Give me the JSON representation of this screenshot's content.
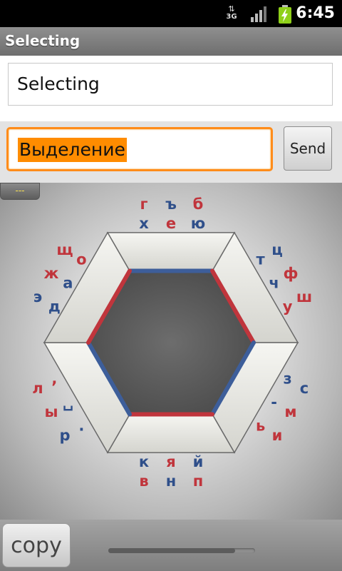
{
  "status_bar": {
    "network_label": "3G",
    "time": "6:45"
  },
  "title_bar": {
    "title": "Selecting"
  },
  "echo": {
    "text": "Selecting"
  },
  "input": {
    "value": "Выделение"
  },
  "send_button": {
    "label": "Send"
  },
  "keyboard_tab": {
    "label": "---"
  },
  "hex_keyboard": {
    "colors": {
      "red": "#c0353c",
      "blue": "#2f4f8a"
    },
    "keys": [
      {
        "ch": "г",
        "c": "red"
      },
      {
        "ch": "ъ",
        "c": "blue"
      },
      {
        "ch": "б",
        "c": "red"
      },
      {
        "ch": "х",
        "c": "blue"
      },
      {
        "ch": "е",
        "c": "red"
      },
      {
        "ch": "ю",
        "c": "blue"
      },
      {
        "ch": "ц",
        "c": "blue"
      },
      {
        "ch": "ф",
        "c": "red"
      },
      {
        "ch": "ш",
        "c": "red"
      },
      {
        "ch": "т",
        "c": "blue"
      },
      {
        "ch": "ч",
        "c": "blue"
      },
      {
        "ch": "у",
        "c": "red"
      },
      {
        "ch": "с",
        "c": "blue"
      },
      {
        "ch": "м",
        "c": "red"
      },
      {
        "ch": "и",
        "c": "red"
      },
      {
        "ch": "з",
        "c": "blue"
      },
      {
        "ch": "-",
        "c": "blue"
      },
      {
        "ch": "ь",
        "c": "red"
      },
      {
        "ch": "п",
        "c": "red"
      },
      {
        "ch": "н",
        "c": "blue"
      },
      {
        "ch": "в",
        "c": "red"
      },
      {
        "ch": "й",
        "c": "blue"
      },
      {
        "ch": "я",
        "c": "red"
      },
      {
        "ch": "к",
        "c": "blue"
      },
      {
        "ch": "р",
        "c": "blue"
      },
      {
        "ch": "ы",
        "c": "red"
      },
      {
        "ch": "л",
        "c": "red"
      },
      {
        "ch": ".",
        "c": "blue"
      },
      {
        "ch": "␣",
        "c": "blue"
      },
      {
        "ch": ",",
        "c": "red"
      },
      {
        "ch": "э",
        "c": "blue"
      },
      {
        "ch": "ж",
        "c": "red"
      },
      {
        "ch": "щ",
        "c": "red"
      },
      {
        "ch": "д",
        "c": "blue"
      },
      {
        "ch": "а",
        "c": "blue"
      },
      {
        "ch": "о",
        "c": "red"
      }
    ]
  },
  "bottom_bar": {
    "copy_label": "copy"
  }
}
